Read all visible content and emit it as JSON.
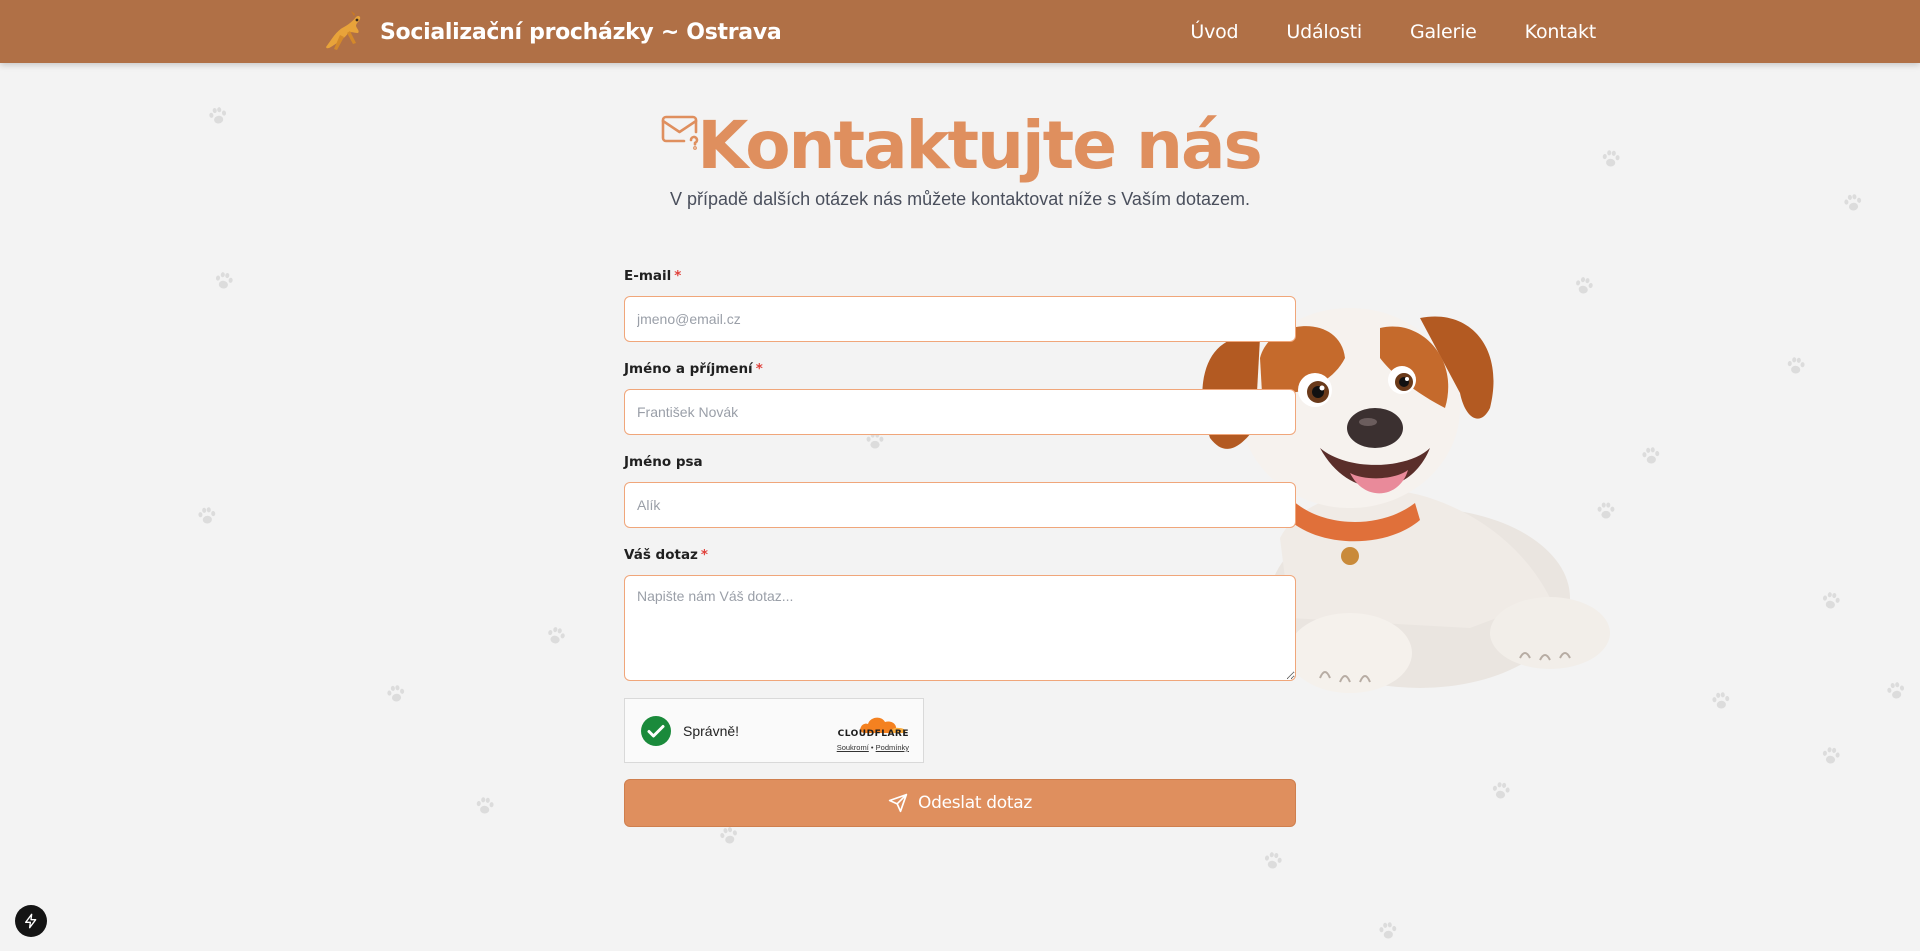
{
  "header": {
    "brand_title": "Socializační procházky ~ Ostrava",
    "nav": [
      {
        "label": "Úvod"
      },
      {
        "label": "Události"
      },
      {
        "label": "Galerie"
      },
      {
        "label": "Kontakt"
      }
    ]
  },
  "main": {
    "title": "Kontaktujte nás",
    "subtitle": "V případě dalších otázek nás můžete kontaktovat níže s Vaším dotazem."
  },
  "form": {
    "email": {
      "label": "E-mail",
      "required_mark": "*",
      "placeholder": "jmeno@email.cz",
      "value": ""
    },
    "name": {
      "label": "Jméno a příjmení",
      "required_mark": "*",
      "placeholder": "František Novák",
      "value": ""
    },
    "dog_name": {
      "label": "Jméno psa",
      "placeholder": "Alík",
      "value": ""
    },
    "question": {
      "label": "Váš dotaz",
      "required_mark": "*",
      "placeholder": "Napište nám Váš dotaz...",
      "value": ""
    },
    "captcha": {
      "status_text": "Správně!",
      "provider": "CLOUDFLARE",
      "privacy_link": "Soukromí",
      "separator": "•",
      "terms_link": "Podmínky"
    },
    "submit_label": "Odeslat dotaz"
  },
  "colors": {
    "header_bg": "#b07046",
    "accent": "#df8f5e",
    "input_border": "#f0a67a",
    "page_bg": "#f3f3f3",
    "success": "#1a8a3b"
  },
  "icons": {
    "brand": "running-dog-logo",
    "heading": "mail-question-icon",
    "submit": "send-icon",
    "captcha_check": "check-circle-icon",
    "decor": "paw-print-icon",
    "dev_badge": "lightning-icon"
  }
}
